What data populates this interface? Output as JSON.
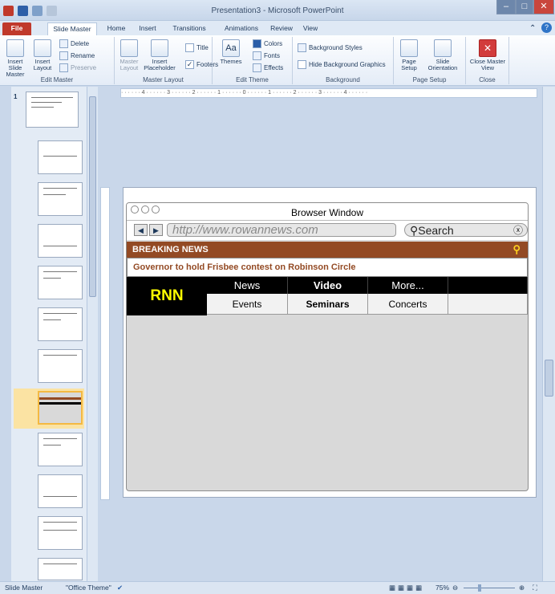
{
  "window": {
    "title": "Presentation3 - Microsoft PowerPoint"
  },
  "tabs": [
    "File",
    "Slide Master",
    "Home",
    "Insert",
    "Transitions",
    "Animations",
    "Review",
    "View"
  ],
  "ribbon": {
    "edit_master": {
      "label": "Edit Master",
      "insert_slide_master": "Insert Slide Master",
      "insert_layout": "Insert Layout",
      "delete": "Delete",
      "rename": "Rename",
      "preserve": "Preserve"
    },
    "master_layout": {
      "label": "Master Layout",
      "master_layout": "Master Layout",
      "insert_placeholder": "Insert Placeholder",
      "title": "Title",
      "footers": "Footers"
    },
    "edit_theme": {
      "label": "Edit Theme",
      "themes": "Themes",
      "colors": "Colors",
      "fonts": "Fonts",
      "effects": "Effects"
    },
    "background": {
      "label": "Background",
      "background_styles": "Background Styles",
      "hide_bg": "Hide Background Graphics"
    },
    "page_setup": {
      "label": "Page Setup",
      "page_setup": "Page Setup",
      "orientation": "Slide Orientation"
    },
    "close": {
      "label": "Close",
      "close_master": "Close Master View"
    }
  },
  "panel": {
    "first_number": "1"
  },
  "ruler": {
    "h": "· · · · · · 4 · · · · · · 3 · · · · · · 2 · · · · · · 1 · · · · · · 0 · · · · · · 1 · · · · · · 2 · · · · · · 3 · · · · · · 4 · · · · · ·"
  },
  "browser": {
    "title": "Browser Window",
    "back": "◀",
    "forward": "▶",
    "url": "http://www.rowannews.com",
    "search": "⚲Search",
    "clear": "ⓧ",
    "breaking": "BREAKING NEWS",
    "headline": "Governor to hold Frisbee contest on Robinson Circle",
    "logo": "RNN",
    "menu_top": [
      "News",
      "Video",
      "More..."
    ],
    "menu_bottom": [
      "Events",
      "Seminars",
      "Concerts"
    ]
  },
  "status": {
    "view": "Slide Master",
    "theme": "\"Office Theme\"",
    "zoom": "75%"
  }
}
